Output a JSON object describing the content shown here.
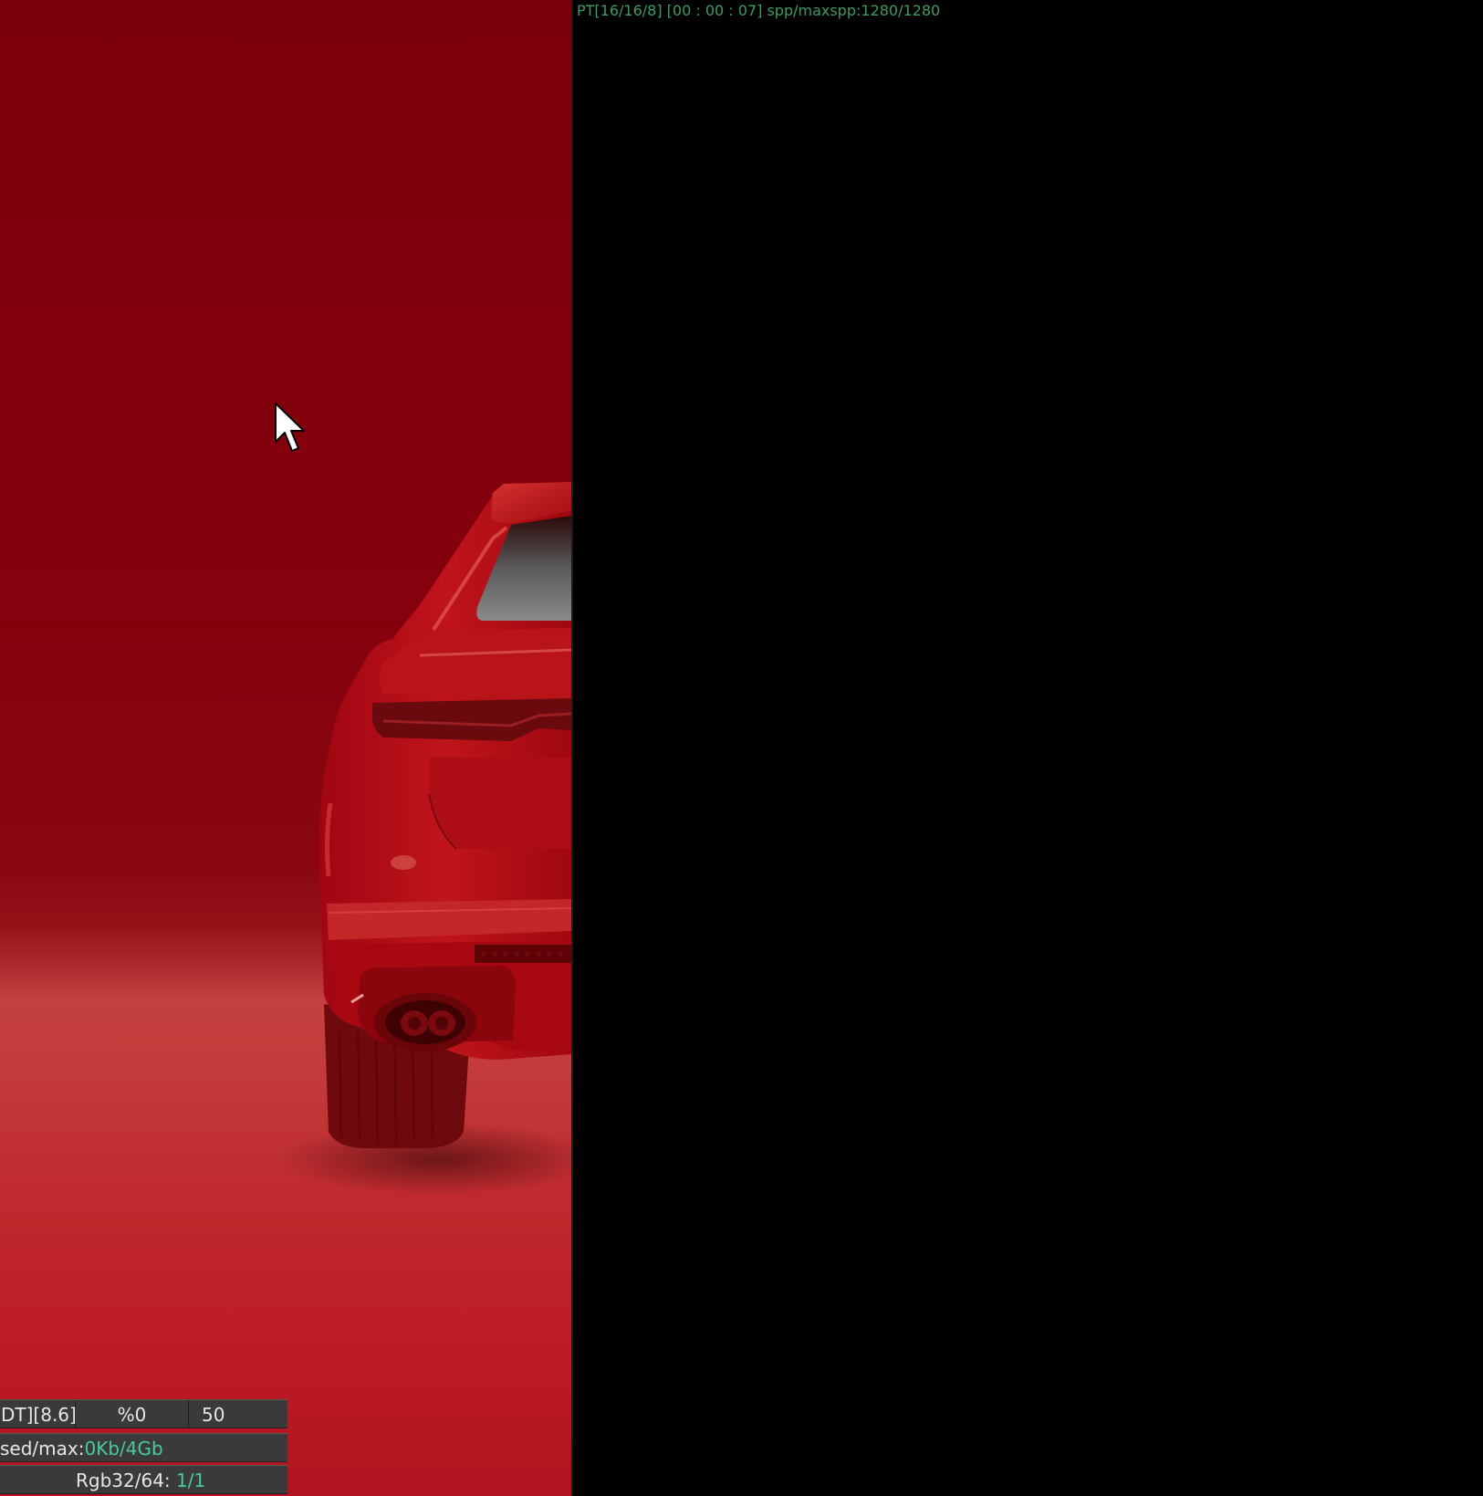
{
  "render_view": {
    "background_color": "#80000c",
    "floor_color": "#c0323a"
  },
  "progress": {
    "text": "PT[16/16/8] [00 : 00 : 07] spp/maxspp:1280/1280",
    "color": "#3f9a62"
  },
  "status_panel": {
    "timing": "DT][8.6]",
    "percent": "%0",
    "value": "50",
    "memory_label": "sed/max:",
    "memory_used": "0Kb",
    "memory_separator": "/",
    "memory_max": "4Gb",
    "rgb_label": "Rgb32/64: ",
    "rgb_value": "1/1",
    "accent_color": "#49c9a3"
  },
  "cursor": {
    "icon": "arrow-cursor-icon"
  }
}
